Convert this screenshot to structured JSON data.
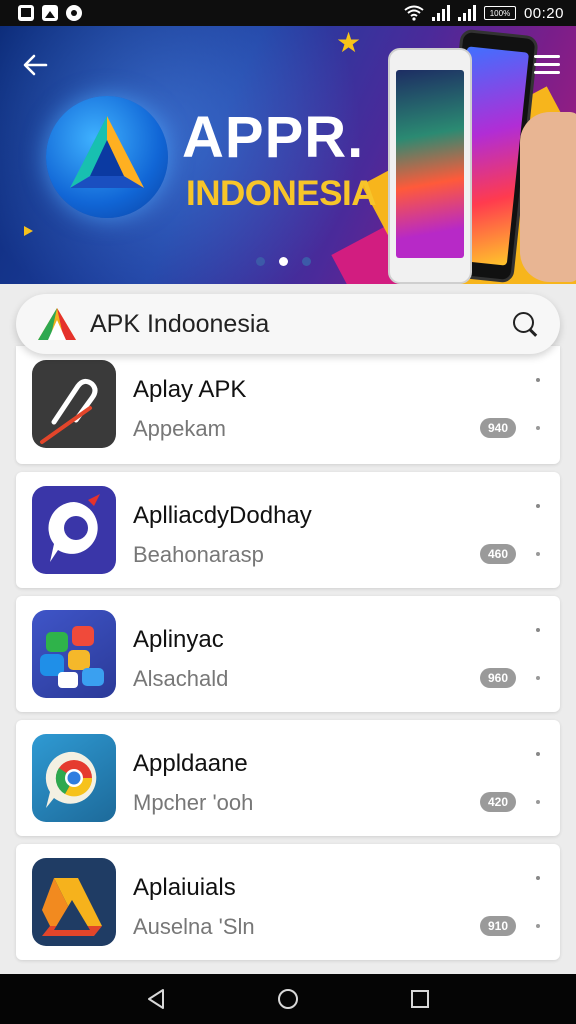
{
  "status_bar": {
    "time": "00:20",
    "battery_text": "100%",
    "icons": [
      "gallery-icon",
      "photo-icon",
      "record-icon",
      "wifi-icon",
      "signal-icon",
      "signal-icon",
      "battery-icon"
    ]
  },
  "banner": {
    "title": "APPR.",
    "subtitle": "INDONESIA",
    "carousel_dots": 3,
    "active_dot": 1
  },
  "search": {
    "value": "APK Indoonesia"
  },
  "apps": [
    {
      "name": "Aplay APK",
      "subtitle": "Appekam",
      "badge": "940"
    },
    {
      "name": "AplliacdyDodhay",
      "subtitle": "Beahonarasp",
      "badge": "460"
    },
    {
      "name": "Aplinyac",
      "subtitle": "Alsachald",
      "badge": "960"
    },
    {
      "name": "Appldaane",
      "subtitle": "Mpcher 'ooh",
      "badge": "420"
    },
    {
      "name": "Aplaiuials",
      "subtitle": "Auselna 'Sln",
      "badge": "910"
    }
  ],
  "colors": {
    "accent": "#f7c52a",
    "banner_blue": "#1f3fa0",
    "banner_pink": "#d21d80"
  }
}
